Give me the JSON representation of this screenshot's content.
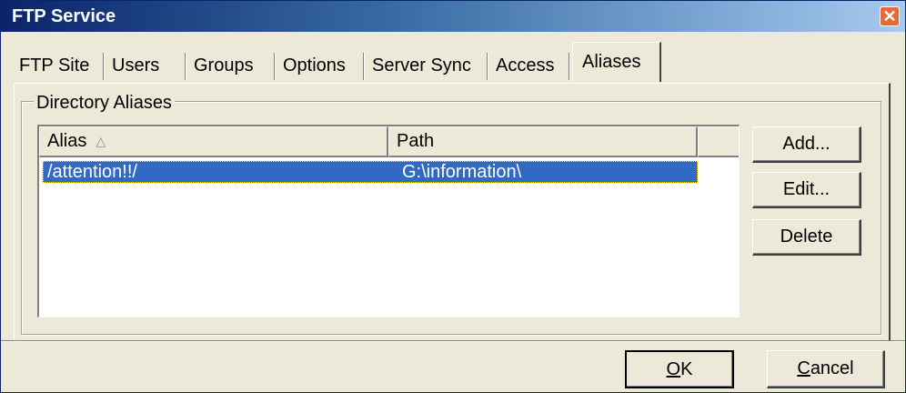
{
  "window": {
    "title": "FTP Service",
    "close_icon": "close-icon"
  },
  "tabs": [
    {
      "label": "FTP Site"
    },
    {
      "label": "Users"
    },
    {
      "label": "Groups"
    },
    {
      "label": "Options"
    },
    {
      "label": "Server Sync"
    },
    {
      "label": "Access"
    },
    {
      "label": "Aliases",
      "active": true
    }
  ],
  "group": {
    "label": "Directory Aliases"
  },
  "list": {
    "columns": [
      {
        "label": "Alias",
        "sort": "ascending",
        "sort_icon": "sort-ascending-icon"
      },
      {
        "label": "Path"
      }
    ],
    "rows": [
      {
        "alias": "/attention!!/",
        "path": "G:\\information\\",
        "selected": true
      }
    ]
  },
  "side_buttons": {
    "add": "Add...",
    "edit": "Edit...",
    "delete": "Delete"
  },
  "footer": {
    "ok_label": "OK",
    "ok_mnemonic": "O",
    "ok_rest": "K",
    "cancel_label": "Cancel",
    "cancel_mnemonic": "C",
    "cancel_rest": "ancel"
  },
  "colors": {
    "titlebar_start": "#0a246a",
    "titlebar_end": "#a6caf0",
    "selection": "#316ac5",
    "close_button": "#e46a3c",
    "face": "#ece9d8"
  }
}
